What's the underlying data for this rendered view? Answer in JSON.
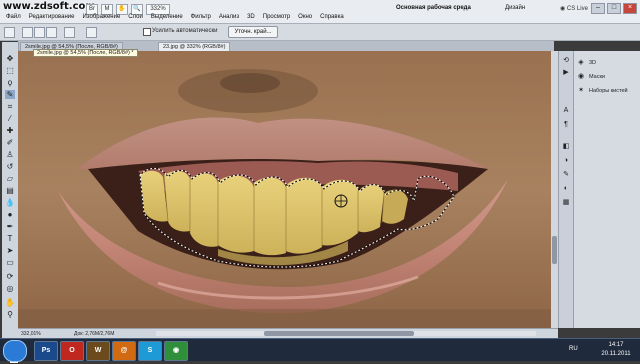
{
  "watermark": "www.zdsoft.com",
  "titlebar": {
    "zoom_value": "332%",
    "workspace": "Основная рабочая среда",
    "design": "Дизайн",
    "cs_live": "CS Live"
  },
  "menus": [
    "Файл",
    "Редактирование",
    "Изображение",
    "Слои",
    "Выделение",
    "Фильтр",
    "Анализ",
    "3D",
    "Просмотр",
    "Окно",
    "Справка"
  ],
  "options": {
    "checkbox_label": "Усилить автоматически",
    "refine_button": "Уточн. край..."
  },
  "tabs": [
    {
      "label": "2smile.jpg @ 54,5% (После, RGB/8#)",
      "active": false
    },
    {
      "label": "23.jpg @ 332% (RGB/8#)",
      "active": true
    }
  ],
  "tooltip": "2smile.jpg @ 54,5% (После, RGB/8#) *",
  "status": {
    "zoom": "332,01%",
    "doc": "Док: 2,76M/2,76M"
  },
  "panels": [
    {
      "label": "3D",
      "icon": "3d-icon"
    },
    {
      "label": "Маски",
      "icon": "masks-icon"
    },
    {
      "label": "Наборы кистей",
      "icon": "brush-presets-icon"
    }
  ],
  "taskbar": {
    "apps": [
      {
        "label": "Ps",
        "color": "#1b4a8c"
      },
      {
        "label": "O",
        "color": "#c0281f"
      },
      {
        "label": "W",
        "color": "#6b4a1b"
      },
      {
        "label": "@",
        "color": "#d26a12"
      },
      {
        "label": "S",
        "color": "#1e9ad6"
      },
      {
        "label": "◉",
        "color": "#2f8f3a"
      }
    ],
    "lang": "RU",
    "time": "14:17",
    "date": "20.11.2011"
  },
  "colors": {
    "skin": "#a07a58",
    "lip": "#c48e80",
    "teeth": "#e0c672",
    "selection": "#ffffff",
    "foreground": "#000000",
    "background": "#ffffff"
  }
}
